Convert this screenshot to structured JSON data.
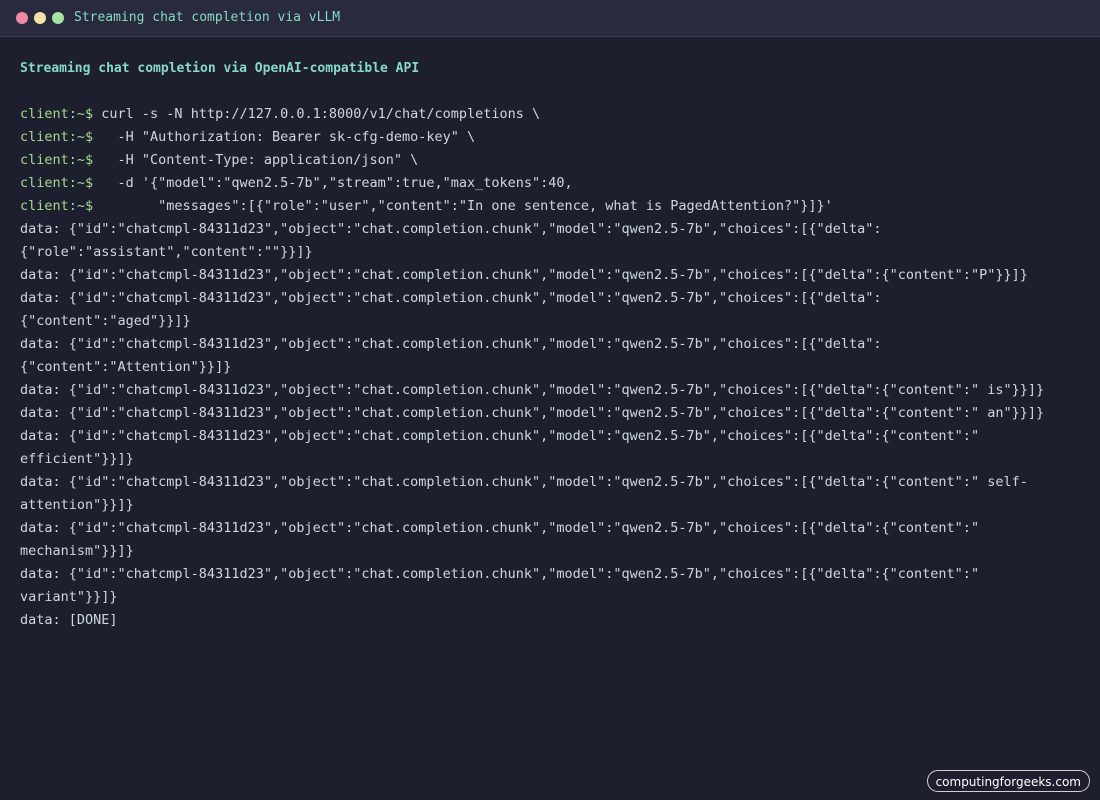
{
  "window": {
    "title": "Streaming chat completion via vLLM"
  },
  "terminal": {
    "heading": "Streaming chat completion via OpenAI-compatible API",
    "prompt": "client:~$",
    "commands": [
      " curl -s -N http://127.0.0.1:8000/v1/chat/completions \\",
      "   -H \"Authorization: Bearer sk-cfg-demo-key\" \\",
      "   -H \"Content-Type: application/json\" \\",
      "   -d '{\"model\":\"qwen2.5-7b\",\"stream\":true,\"max_tokens\":40,",
      "        \"messages\":[{\"role\":\"user\",\"content\":\"In one sentence, what is PagedAttention?\"}]}'"
    ],
    "output": [
      "data: {\"id\":\"chatcmpl-84311d23\",\"object\":\"chat.completion.chunk\",\"model\":\"qwen2.5-7b\",\"choices\":[{\"delta\":\n{\"role\":\"assistant\",\"content\":\"\"}}]}",
      "data: {\"id\":\"chatcmpl-84311d23\",\"object\":\"chat.completion.chunk\",\"model\":\"qwen2.5-7b\",\"choices\":[{\"delta\":{\"content\":\"P\"}}]}",
      "data: {\"id\":\"chatcmpl-84311d23\",\"object\":\"chat.completion.chunk\",\"model\":\"qwen2.5-7b\",\"choices\":[{\"delta\":\n{\"content\":\"aged\"}}]}",
      "data: {\"id\":\"chatcmpl-84311d23\",\"object\":\"chat.completion.chunk\",\"model\":\"qwen2.5-7b\",\"choices\":[{\"delta\":\n{\"content\":\"Attention\"}}]}",
      "data: {\"id\":\"chatcmpl-84311d23\",\"object\":\"chat.completion.chunk\",\"model\":\"qwen2.5-7b\",\"choices\":[{\"delta\":{\"content\":\" is\"}}]}",
      "data: {\"id\":\"chatcmpl-84311d23\",\"object\":\"chat.completion.chunk\",\"model\":\"qwen2.5-7b\",\"choices\":[{\"delta\":{\"content\":\" an\"}}]}",
      "data: {\"id\":\"chatcmpl-84311d23\",\"object\":\"chat.completion.chunk\",\"model\":\"qwen2.5-7b\",\"choices\":[{\"delta\":{\"content\":\"\nefficient\"}}]}",
      "data: {\"id\":\"chatcmpl-84311d23\",\"object\":\"chat.completion.chunk\",\"model\":\"qwen2.5-7b\",\"choices\":[{\"delta\":{\"content\":\" self-\nattention\"}}]}",
      "data: {\"id\":\"chatcmpl-84311d23\",\"object\":\"chat.completion.chunk\",\"model\":\"qwen2.5-7b\",\"choices\":[{\"delta\":{\"content\":\"\nmechanism\"}}]}",
      "data: {\"id\":\"chatcmpl-84311d23\",\"object\":\"chat.completion.chunk\",\"model\":\"qwen2.5-7b\",\"choices\":[{\"delta\":{\"content\":\"\nvariant\"}}]}",
      "data: [DONE]"
    ]
  },
  "watermark": "computingforgeeks.com",
  "colors": {
    "background": "#1e1f2e",
    "titlebar": "#292a3b",
    "accent": "#87d9c9",
    "prompt": "#a6d98c",
    "text": "#cdd6e4",
    "dot_red": "#f08aa4",
    "dot_yellow": "#f5e0a7",
    "dot_green": "#a6e3a1"
  }
}
